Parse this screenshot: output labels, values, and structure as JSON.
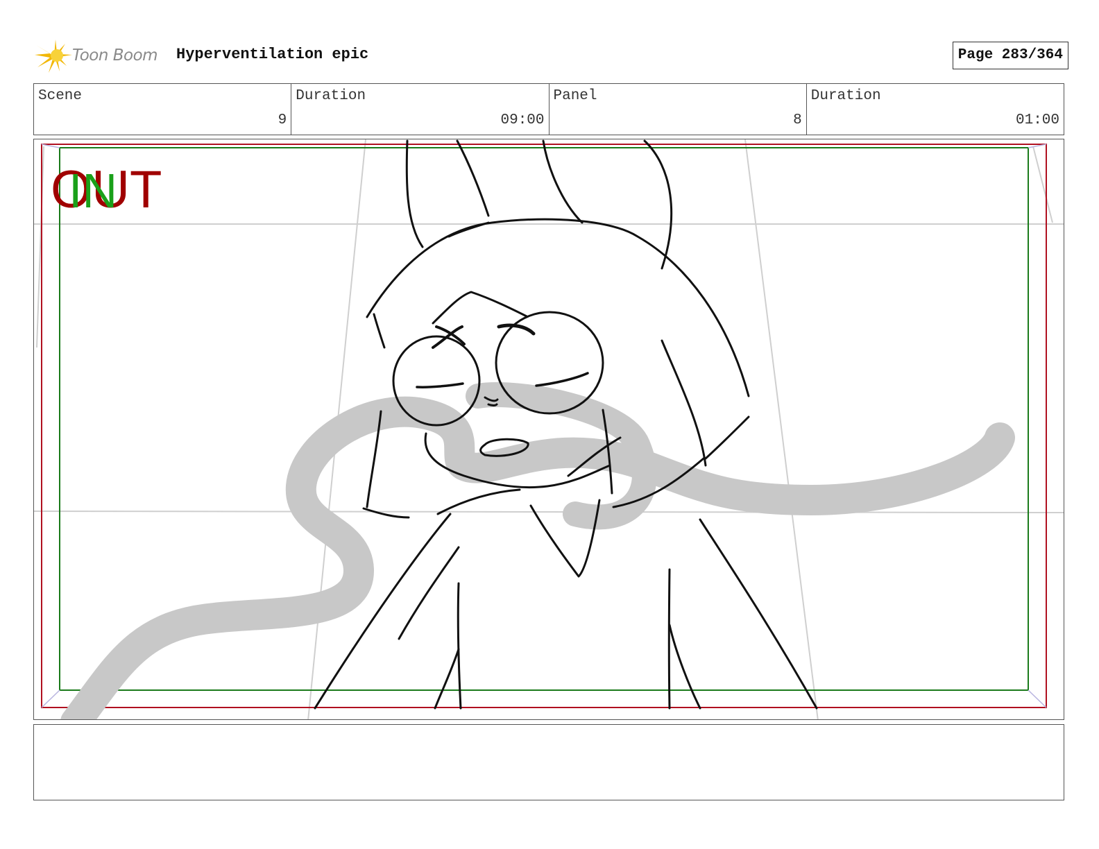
{
  "header": {
    "logo_text": "Toon Boom",
    "project_title": "Hyperventilation epic",
    "page_label": "Page 283/364"
  },
  "info": {
    "scene_label": "Scene",
    "scene_value": "9",
    "scene_duration_label": "Duration",
    "scene_duration_value": "09:00",
    "panel_label": "Panel",
    "panel_value": "8",
    "panel_duration_label": "Duration",
    "panel_duration_value": "01:00"
  },
  "panel": {
    "out_marker": "OUT",
    "in_marker": "IN",
    "out_color": "#a00000",
    "in_color": "#1aa01a",
    "frame_red": "#b01020",
    "frame_green": "#1a7a1a"
  },
  "notes": {
    "text": ""
  }
}
